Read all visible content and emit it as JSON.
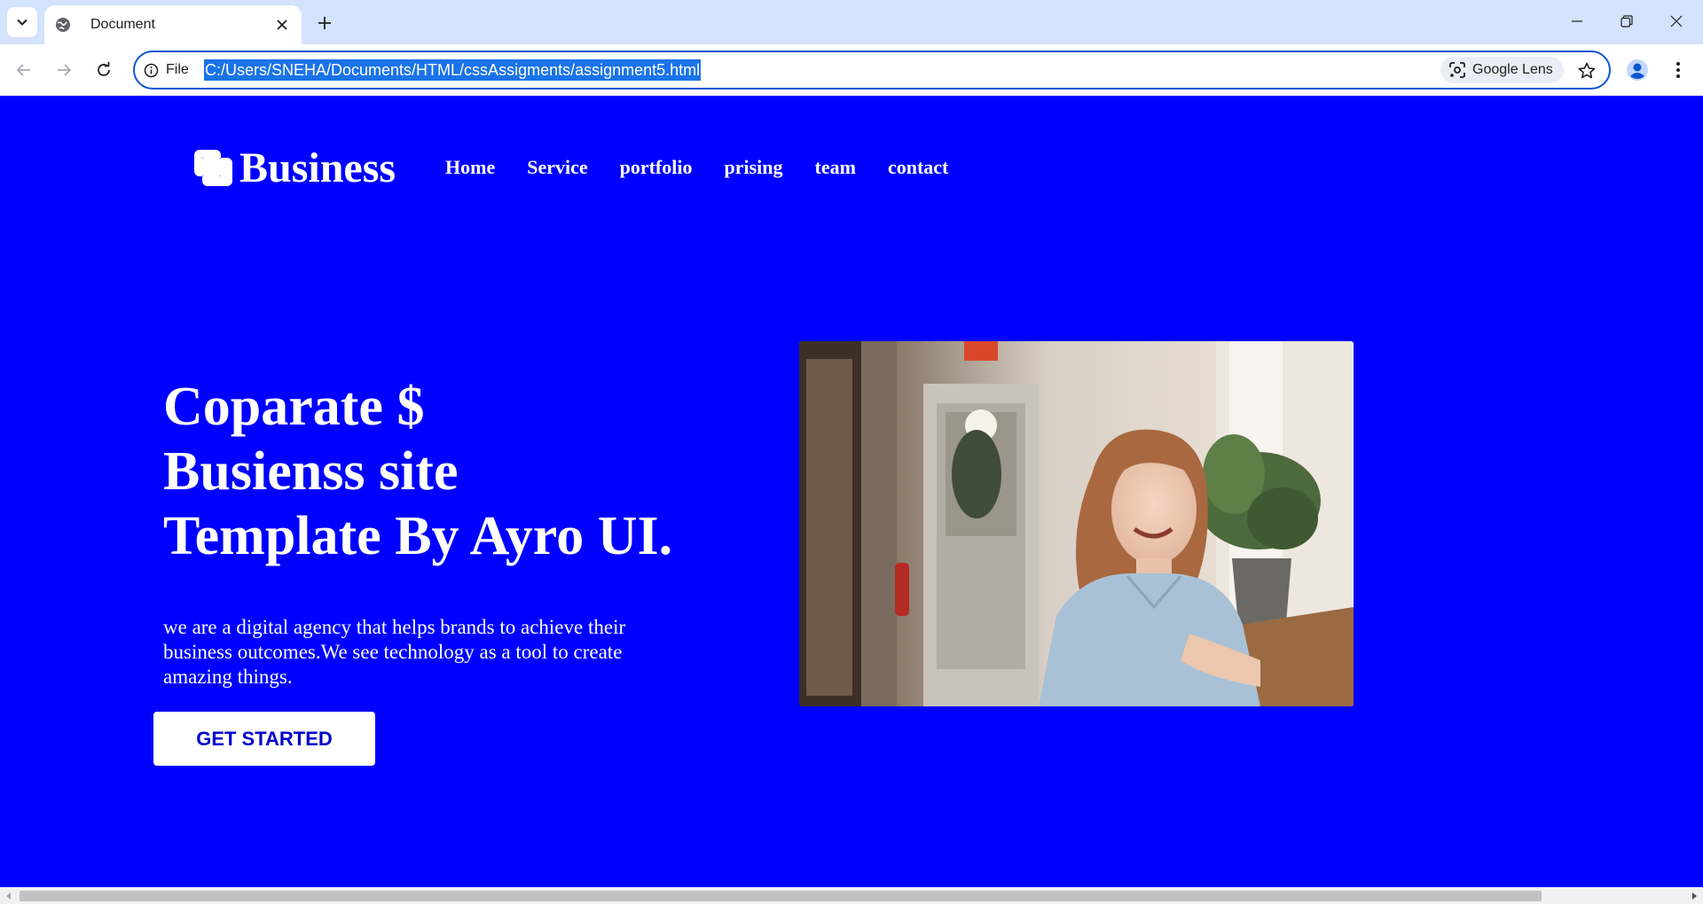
{
  "browser": {
    "tab_title": "Document",
    "site_chip_label": "File",
    "url": "C:/Users/SNEHA/Documents/HTML/cssAssigments/assignment5.html",
    "lens_label": "Google Lens",
    "icons": {
      "tab_search": "chevron-down-icon",
      "favicon": "globe-icon",
      "tab_close": "close-icon",
      "new_tab": "plus-icon",
      "minimize": "minimize-icon",
      "restore": "restore-icon",
      "close_window": "close-icon",
      "back": "arrow-left-icon",
      "forward": "arrow-right-icon",
      "reload": "reload-icon",
      "site_info": "info-icon",
      "lens": "lens-icon",
      "bookmark": "star-icon",
      "profile": "profile-icon",
      "menu": "kebab-menu-icon"
    }
  },
  "page": {
    "colors": {
      "background": "#0000ff",
      "text": "#ffffff",
      "button_bg": "#ffffff",
      "button_text": "#0000cc"
    },
    "logo_text": "Business",
    "nav": [
      "Home",
      "Service",
      "portfolio",
      "prising",
      "team",
      "contact"
    ],
    "hero": {
      "title_lines": [
        "Coparate $",
        "Busienss site",
        "Template By Ayro UI."
      ],
      "description": "we are a digital agency that helps brands to achieve their business outcomes.We see technology as a tool to create amazing things.",
      "cta_label": "GET STARTED"
    },
    "image": {
      "subject": "woman smiling in office photo"
    }
  }
}
